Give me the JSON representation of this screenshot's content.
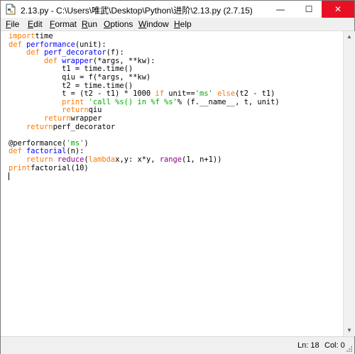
{
  "window": {
    "title": "2.13.py - C:\\Users\\唯武\\Desktop\\Python\\进阶\\2.13.py (2.7.15)",
    "controls": {
      "minimize": "—",
      "maximize": "☐",
      "close": "✕"
    }
  },
  "menu": [
    {
      "label": "File",
      "key": "F",
      "rest": "ile"
    },
    {
      "label": "Edit",
      "key": "E",
      "rest": "dit"
    },
    {
      "label": "Format",
      "key": "F",
      "rest": "ormat"
    },
    {
      "label": "Run",
      "key": "R",
      "rest": "un"
    },
    {
      "label": "Options",
      "key": "O",
      "rest": "ptions"
    },
    {
      "label": "Window",
      "key": "W",
      "rest": "indow"
    },
    {
      "label": "Help",
      "key": "H",
      "rest": "elp"
    }
  ],
  "code": {
    "lines": [
      [
        [
          "kw",
          "import"
        ],
        [
          "",
          "time"
        ]
      ],
      [
        [
          "kw",
          "def"
        ],
        [
          "",
          ""
        ],
        [
          "df",
          "performance"
        ],
        [
          "",
          "(unit):"
        ]
      ],
      [
        [
          "",
          "    "
        ],
        [
          "kw",
          "def"
        ],
        [
          "",
          ""
        ],
        [
          "df",
          "perf_decorator"
        ],
        [
          "",
          "(f):"
        ]
      ],
      [
        [
          "",
          "        "
        ],
        [
          "kw",
          "def"
        ],
        [
          "",
          ""
        ],
        [
          "df",
          "wrapper"
        ],
        [
          "",
          "(*args, **kw):"
        ]
      ],
      [
        [
          "",
          "            t1 = time.time()"
        ]
      ],
      [
        [
          "",
          "            qiu = f(*args, **kw)"
        ]
      ],
      [
        [
          "",
          "            t2 = time.time()"
        ]
      ],
      [
        [
          "",
          "            t = (t2 - t1) * 1000 "
        ],
        [
          "kw",
          "if"
        ],
        [
          "",
          ""
        ],
        [
          "",
          "unit=="
        ],
        [
          "st",
          "'ms'"
        ],
        [
          "",
          ""
        ],
        [
          "kw",
          "else"
        ],
        [
          "",
          "(t2 - t1)"
        ]
      ],
      [
        [
          "",
          "            "
        ],
        [
          "kw",
          "print"
        ],
        [
          "",
          ""
        ],
        [
          "st",
          "'call %s() in %f %s'"
        ],
        [
          "",
          "% (f.__name__, t, unit)"
        ]
      ],
      [
        [
          "",
          "            "
        ],
        [
          "kw",
          "return"
        ],
        [
          "",
          "qiu"
        ]
      ],
      [
        [
          "",
          "        "
        ],
        [
          "kw",
          "return"
        ],
        [
          "",
          "wrapper"
        ]
      ],
      [
        [
          "",
          "    "
        ],
        [
          "kw",
          "return"
        ],
        [
          "",
          "perf_decorator"
        ]
      ],
      [
        [
          "",
          ""
        ]
      ],
      [
        [
          "",
          "@performance("
        ],
        [
          "st",
          "'ms'"
        ],
        [
          "",
          ")"
        ]
      ],
      [
        [
          "kw",
          "def"
        ],
        [
          "",
          ""
        ],
        [
          "df",
          "factorial"
        ],
        [
          "",
          "(n):"
        ]
      ],
      [
        [
          "",
          "    "
        ],
        [
          "kw",
          "return"
        ],
        [
          "",
          ""
        ],
        [
          "bi",
          "reduce"
        ],
        [
          "",
          "("
        ],
        [
          "kw",
          "lambda"
        ],
        [
          "",
          "x,y: x*y, "
        ],
        [
          "bi",
          "range"
        ],
        [
          "",
          "(1, n+1))"
        ]
      ],
      [
        [
          "kw",
          "print"
        ],
        [
          "",
          "factorial(10)"
        ]
      ]
    ]
  },
  "status": {
    "line": "Ln: 18",
    "col": "Col: 0"
  }
}
